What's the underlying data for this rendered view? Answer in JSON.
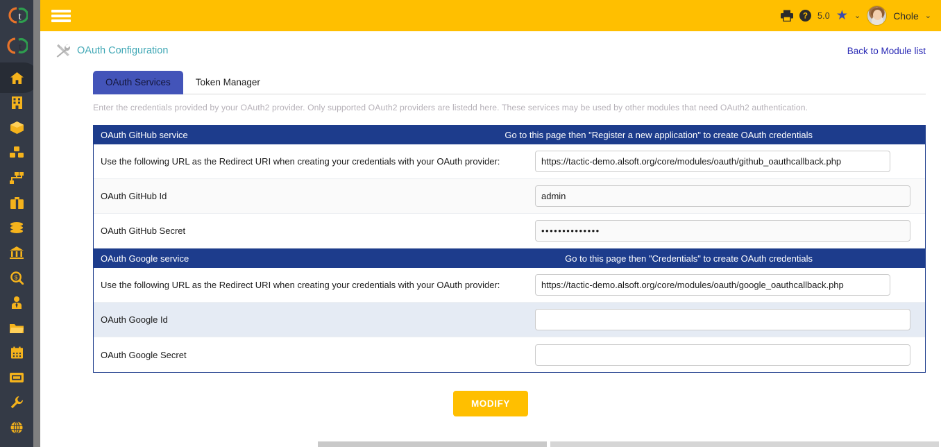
{
  "colors": {
    "topbar": "#ffbf00",
    "sidebar": "#343a46",
    "sidebar_icon": "#f5b31c",
    "section_header": "#1d3c8c",
    "active_tab": "#4354b9",
    "title_link": "#3fa7b5",
    "primary_button": "#ffbf00",
    "highlight_row": "#e5ebf4"
  },
  "sidebar": {
    "logo_label": "tactic-logo",
    "items": [
      {
        "name": "home",
        "icon": "home-icon",
        "active": true
      },
      {
        "name": "company",
        "icon": "building-icon",
        "active": false
      },
      {
        "name": "products",
        "icon": "box-icon",
        "active": false
      },
      {
        "name": "stock",
        "icon": "cubes-icon",
        "active": false
      },
      {
        "name": "projects",
        "icon": "sitemap-icon",
        "active": false
      },
      {
        "name": "commercial",
        "icon": "briefcase-icon",
        "active": false
      },
      {
        "name": "billing",
        "icon": "coins-icon",
        "active": false
      },
      {
        "name": "accounting",
        "icon": "bank-icon",
        "active": false
      },
      {
        "name": "reports",
        "icon": "search-dollar-icon",
        "active": false
      },
      {
        "name": "hrm",
        "icon": "user-tie-icon",
        "active": false
      },
      {
        "name": "documents",
        "icon": "folder-icon",
        "active": false
      },
      {
        "name": "agenda",
        "icon": "calendar-icon",
        "active": false
      },
      {
        "name": "ticket",
        "icon": "ticket-icon",
        "active": false
      },
      {
        "name": "tools",
        "icon": "wrench-icon",
        "active": false
      },
      {
        "name": "website",
        "icon": "globe-icon",
        "active": false
      }
    ]
  },
  "topbar": {
    "menu_icon": "hamburger-icon",
    "print_icon": "printer-icon",
    "help_icon": "question-circle-icon",
    "version": "5.0",
    "bookmark_icon": "star-icon",
    "bookmark_chevron": "⌄",
    "user_name": "Chole",
    "user_chevron": "⌄",
    "avatar_label": "user-avatar"
  },
  "page": {
    "icon": "tools-icon",
    "title": "OAuth Configuration",
    "back_link": "Back to Module list",
    "intro": "Enter the credentials provided by your OAuth2 provider. Only supported OAuth2 providers are listedd here. These services may be used by other modules that need OAuth2 authentication."
  },
  "tabs": [
    {
      "label": "OAuth Services",
      "active": true
    },
    {
      "label": "Token Manager",
      "active": false
    }
  ],
  "services": [
    {
      "title": "OAuth GitHub service",
      "note_prefix": "Go to",
      "note_link": "this page",
      "note_suffix": "then \"Register a new application\" to create OAuth credentials",
      "rows": [
        {
          "label": "Use the following URL as the Redirect URI when creating your credentials with your OAuth provider:",
          "value": "https://tactic-demo.alsoft.org/core/modules/oauth/github_oauthcallback.php",
          "type": "url",
          "highlight": "none"
        },
        {
          "label": "OAuth GitHub Id",
          "value": "admin",
          "type": "text",
          "highlight": "alt"
        },
        {
          "label": "OAuth GitHub Secret",
          "value": "••••••••••••••",
          "type": "password",
          "highlight": "none"
        }
      ]
    },
    {
      "title": "OAuth Google service",
      "note_prefix": "Go to",
      "note_link": "this page",
      "note_suffix": "then \"Credentials\" to create OAuth credentials",
      "rows": [
        {
          "label": "Use the following URL as the Redirect URI when creating your credentials with your OAuth provider:",
          "value": "https://tactic-demo.alsoft.org/core/modules/oauth/google_oauthcallback.php",
          "type": "url",
          "highlight": "none"
        },
        {
          "label": "OAuth Google Id",
          "value": "",
          "type": "text",
          "highlight": "hl"
        },
        {
          "label": "OAuth Google Secret",
          "value": "",
          "type": "text",
          "highlight": "none"
        }
      ]
    }
  ],
  "footer": {
    "modify_label": "MODIFY"
  }
}
